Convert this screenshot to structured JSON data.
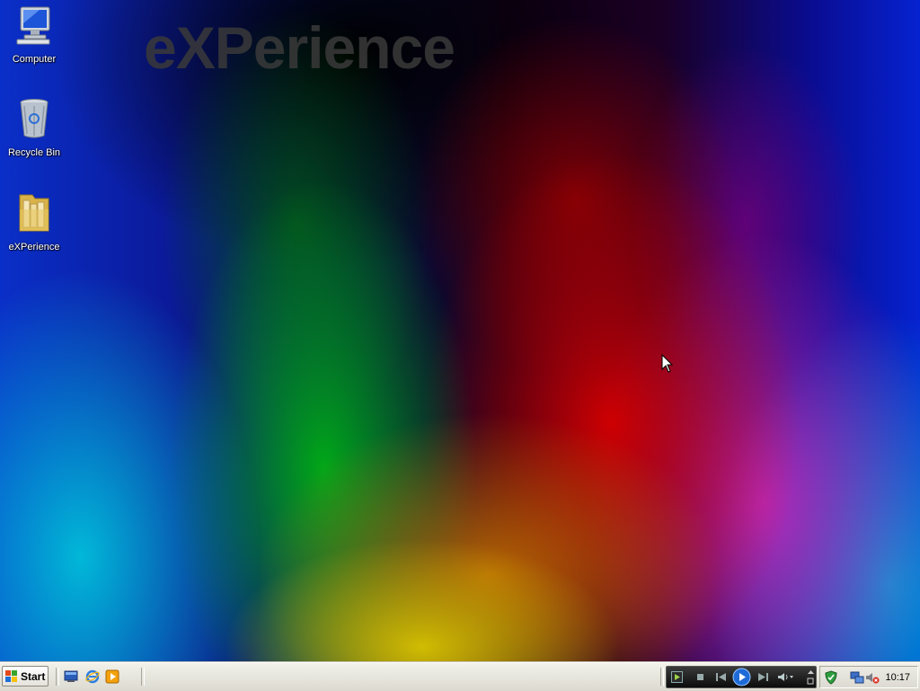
{
  "desktop": {
    "watermark": "eXPerience",
    "icons": [
      {
        "label": "Computer",
        "icon": "computer-icon"
      },
      {
        "label": "Recycle Bin",
        "icon": "recycle-bin-icon"
      },
      {
        "label": "eXPerience",
        "icon": "folder-icon"
      }
    ]
  },
  "taskbar": {
    "start_label": "Start",
    "quick_launch": [
      "show-desktop-icon",
      "internet-explorer-icon",
      "media-player-icon"
    ],
    "media_controls": [
      "stop-icon",
      "previous-icon",
      "play-icon",
      "next-icon",
      "volume-icon"
    ],
    "tray_icons": [
      "security-shield-icon",
      "network-icon",
      "volume-muted-icon"
    ],
    "clock": "10:17"
  }
}
